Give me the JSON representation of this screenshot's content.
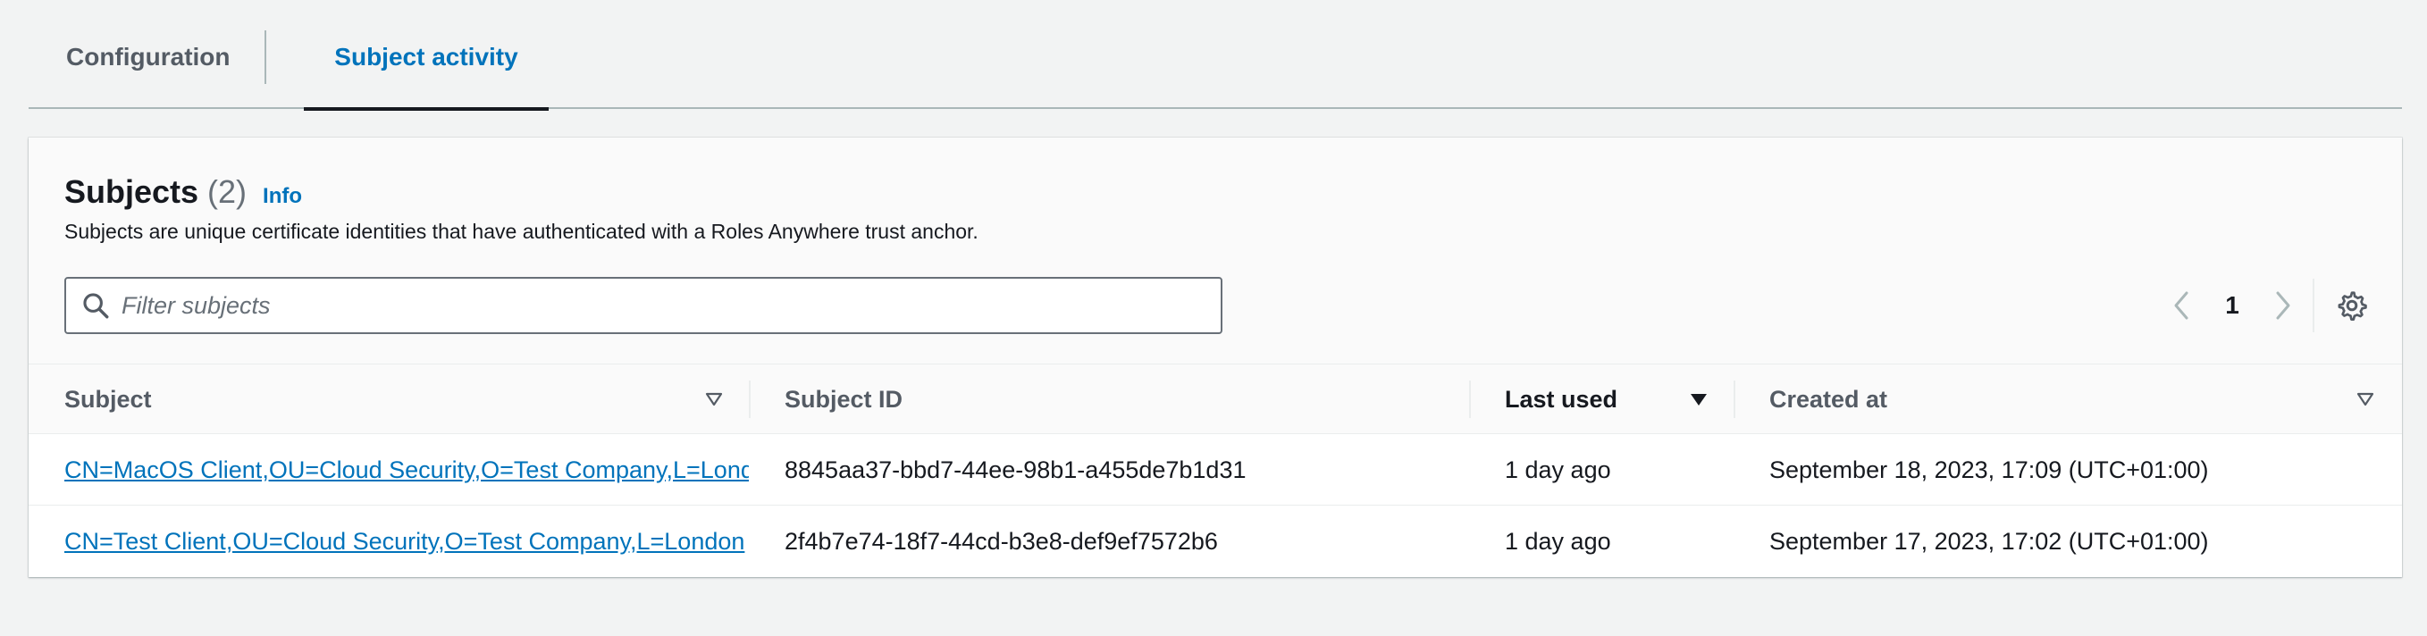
{
  "tabs": [
    {
      "label": "Configuration",
      "active": false
    },
    {
      "label": "Subject activity",
      "active": true
    }
  ],
  "panel": {
    "title": "Subjects",
    "count": "(2)",
    "info_link": "Info",
    "description": "Subjects are unique certificate identities that have authenticated with a Roles Anywhere trust anchor.",
    "search_placeholder": "Filter subjects",
    "search_value": "",
    "pagination": {
      "current_page": "1"
    }
  },
  "table": {
    "columns": [
      "Subject",
      "Subject ID",
      "Last used",
      "Created at"
    ],
    "sorted_column": "Last used",
    "rows": [
      {
        "subject": "CN=MacOS Client,OU=Cloud Security,O=Test Company,L=London",
        "subject_id": "8845aa37-bbd7-44ee-98b1-a455de7b1d31",
        "last_used": "1 day ago",
        "created_at": "September 18, 2023, 17:09 (UTC+01:00)"
      },
      {
        "subject": "CN=Test Client,OU=Cloud Security,O=Test Company,L=London",
        "subject_id": "2f4b7e74-18f7-44cd-b3e8-def9ef7572b6",
        "last_used": "1 day ago",
        "created_at": "September 17, 2023, 17:02 (UTC+01:00)"
      }
    ]
  },
  "colors": {
    "accent": "#0073bb",
    "text": "#16191f",
    "muted": "#545b64",
    "background": "#f2f3f3"
  },
  "icons": [
    "search-icon",
    "chevron-left-icon",
    "chevron-right-icon",
    "gear-icon",
    "sort-icon"
  ]
}
